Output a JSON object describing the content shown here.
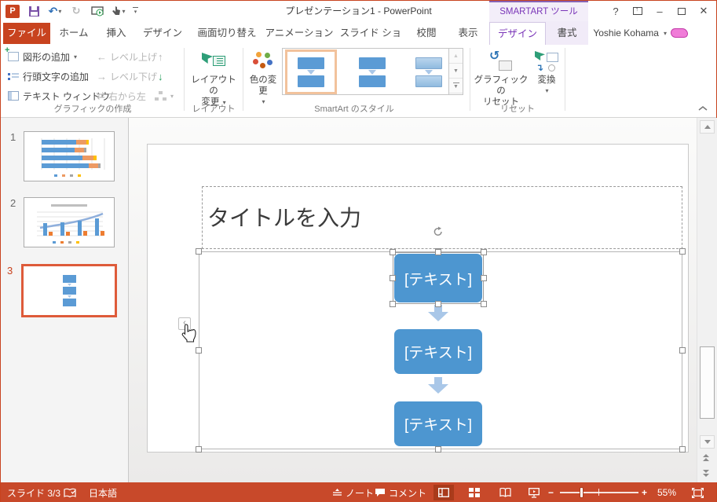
{
  "titlebar": {
    "title": "プレゼンテーション1 - PowerPoint",
    "contextual_header": "SMARTART ツール"
  },
  "tabs": {
    "file": "ファイル",
    "main": [
      "ホーム",
      "挿入",
      "デザイン",
      "画面切り替え",
      "アニメーション",
      "スライド ショー",
      "校閲",
      "表示"
    ],
    "contextual": [
      "デザイン",
      "書式"
    ],
    "account": "Yoshie Kohama"
  },
  "ribbon": {
    "create_graphic": {
      "label": "グラフィックの作成",
      "add_shape": "図形の追加",
      "add_bullet": "行頭文字の追加",
      "text_pane": "テキスト ウィンドウ",
      "promote": "レベル上げ",
      "demote": "レベル下げ",
      "right_to_left": "右から左"
    },
    "layouts": {
      "label": "レイアウト",
      "change_layout_1": "レイアウトの",
      "change_layout_2": "変更"
    },
    "styles": {
      "label": "SmartArt のスタイル",
      "change_colors": "色の変更"
    },
    "reset": {
      "label": "リセット",
      "reset_graphic_1": "グラフィックの",
      "reset_graphic_2": "リセット",
      "convert": "変換"
    }
  },
  "slides": {
    "items": [
      {
        "num": "1"
      },
      {
        "num": "2"
      },
      {
        "num": "3"
      }
    ]
  },
  "slide": {
    "title_placeholder": "タイトルを入力",
    "nodes": [
      "[テキスト]",
      "[テキスト]",
      "[テキスト]"
    ]
  },
  "statusbar": {
    "slide_indicator": "スライド 3/3",
    "language": "日本語",
    "notes": "ノート",
    "comments": "コメント",
    "zoom": "55%"
  },
  "icons": {
    "dropdown": "▾",
    "undo": "↶",
    "redo": "↻",
    "promote_arrow": "←",
    "demote_arrow": "→",
    "swap_arrows": "⇄",
    "move_up": "↑",
    "move_down": "↓",
    "gallery_up": "▲",
    "gallery_down": "▼",
    "pane_toggle": "‹",
    "help": "?",
    "minimize": "–",
    "close": "✕",
    "zoom_out": "－",
    "zoom_in": "＋"
  },
  "colors": {
    "accent": "#C8431F",
    "statusbar": "#C8492A",
    "contextual_purple": "#7A35B8",
    "smartart_blue": "#4D96D0",
    "smartart_arrow": "#A9C7E8",
    "selection_peach": "#F2C29C",
    "selected_thumb_border": "#DE5B3A"
  }
}
